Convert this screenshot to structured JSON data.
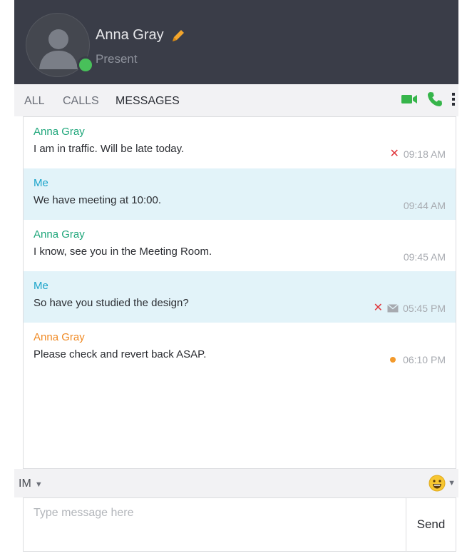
{
  "contact": {
    "name": "Anna Gray",
    "status": "Present",
    "status_color": "#48c05a"
  },
  "tabs": [
    {
      "label": "ALL",
      "active": false
    },
    {
      "label": "CALLS",
      "active": false
    },
    {
      "label": "MESSAGES",
      "active": true
    }
  ],
  "actions": {
    "video_icon": "video-camera-icon",
    "call_icon": "phone-icon",
    "more_icon": "more-vertical-icon",
    "accent_color": "#36b54a"
  },
  "messages": [
    {
      "sender": "Anna Gray",
      "sender_color": "#1ea67a",
      "text": "I am in traffic. Will be late today.",
      "time": "09:18 AM",
      "status": "failed",
      "from_me": false
    },
    {
      "sender": "Me",
      "sender_color": "#1aa3c9",
      "text": "We have meeting at 10:00.",
      "time": "09:44 AM",
      "status": "",
      "from_me": true
    },
    {
      "sender": "Anna Gray",
      "sender_color": "#1ea67a",
      "text": "I know, see you in the Meeting Room.",
      "time": "09:45 AM",
      "status": "",
      "from_me": false
    },
    {
      "sender": "Me",
      "sender_color": "#1aa3c9",
      "text": "So have you studied the design?",
      "time": "05:45 PM",
      "status": "failed-sms",
      "from_me": true
    },
    {
      "sender": "Anna Gray",
      "sender_color": "#f08a24",
      "text": "Please check and revert back ASAP.",
      "time": "06:10 PM",
      "status": "unread",
      "from_me": false
    }
  ],
  "composer": {
    "mode": "IM",
    "placeholder": "Type message here",
    "value": "",
    "send_label": "Send",
    "emoji_icon": "smiley-icon"
  }
}
